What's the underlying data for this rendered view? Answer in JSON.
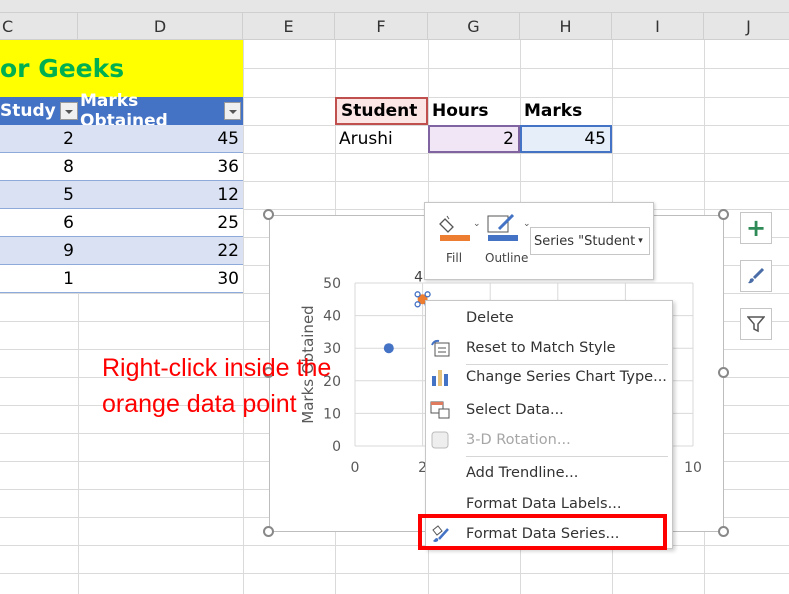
{
  "columns": [
    "C",
    "D",
    "E",
    "F",
    "G",
    "H",
    "I",
    "J"
  ],
  "title_cell": "or Geeks",
  "table": {
    "headers": [
      "Study",
      "Marks Obtained"
    ],
    "rows": [
      [
        "2",
        "45"
      ],
      [
        "8",
        "36"
      ],
      [
        "5",
        "12"
      ],
      [
        "6",
        "25"
      ],
      [
        "9",
        "22"
      ],
      [
        "1",
        "30"
      ]
    ]
  },
  "small_table": {
    "headers": [
      "Student",
      "Hours",
      "Marks"
    ],
    "row": [
      "Arushi",
      "2",
      "45"
    ]
  },
  "chart": {
    "y_axis_title": "Marks Obtained",
    "y_ticks": [
      "0",
      "10",
      "20",
      "30",
      "40",
      "50"
    ],
    "x_ticks": [
      "0",
      "2",
      "10"
    ],
    "data_label": "4",
    "chart_data": {
      "type": "scatter",
      "ylim": [
        0,
        50
      ],
      "xlim": [
        0,
        10
      ],
      "series": [
        {
          "points": [
            [
              1,
              30
            ]
          ],
          "color": "#4472c4"
        },
        {
          "points": [
            [
              2,
              45
            ]
          ],
          "color": "#ed7d31"
        }
      ]
    }
  },
  "annotation": {
    "line1": "Right-click inside the",
    "line2": "orange data point",
    "color": "#ff0000"
  },
  "mini_toolbar": {
    "fill_label": "Fill",
    "outline_label": "Outline",
    "series_select": "Series \"Student",
    "fill_color": "#ed7d31",
    "outline_color": "#4472c4"
  },
  "context_menu": {
    "items": [
      {
        "label": "Delete",
        "icon": ""
      },
      {
        "label": "Reset to Match Style",
        "icon": "reset-style-icon"
      },
      {
        "label": "Change Series Chart Type...",
        "icon": "chart-type-icon"
      },
      {
        "label": "Select Data...",
        "icon": "select-data-icon"
      },
      {
        "label": "3-D Rotation...",
        "icon": "3d-rotation-icon",
        "disabled": true
      },
      {
        "label": "Add Trendline...",
        "icon": ""
      },
      {
        "label": "Format Data Labels...",
        "icon": ""
      },
      {
        "label": "Format Data Series...",
        "icon": "format-series-icon",
        "highlighted": true
      }
    ]
  },
  "side_buttons": [
    "chart-elements-plus-icon",
    "chart-styles-brush-icon",
    "chart-filter-icon"
  ]
}
